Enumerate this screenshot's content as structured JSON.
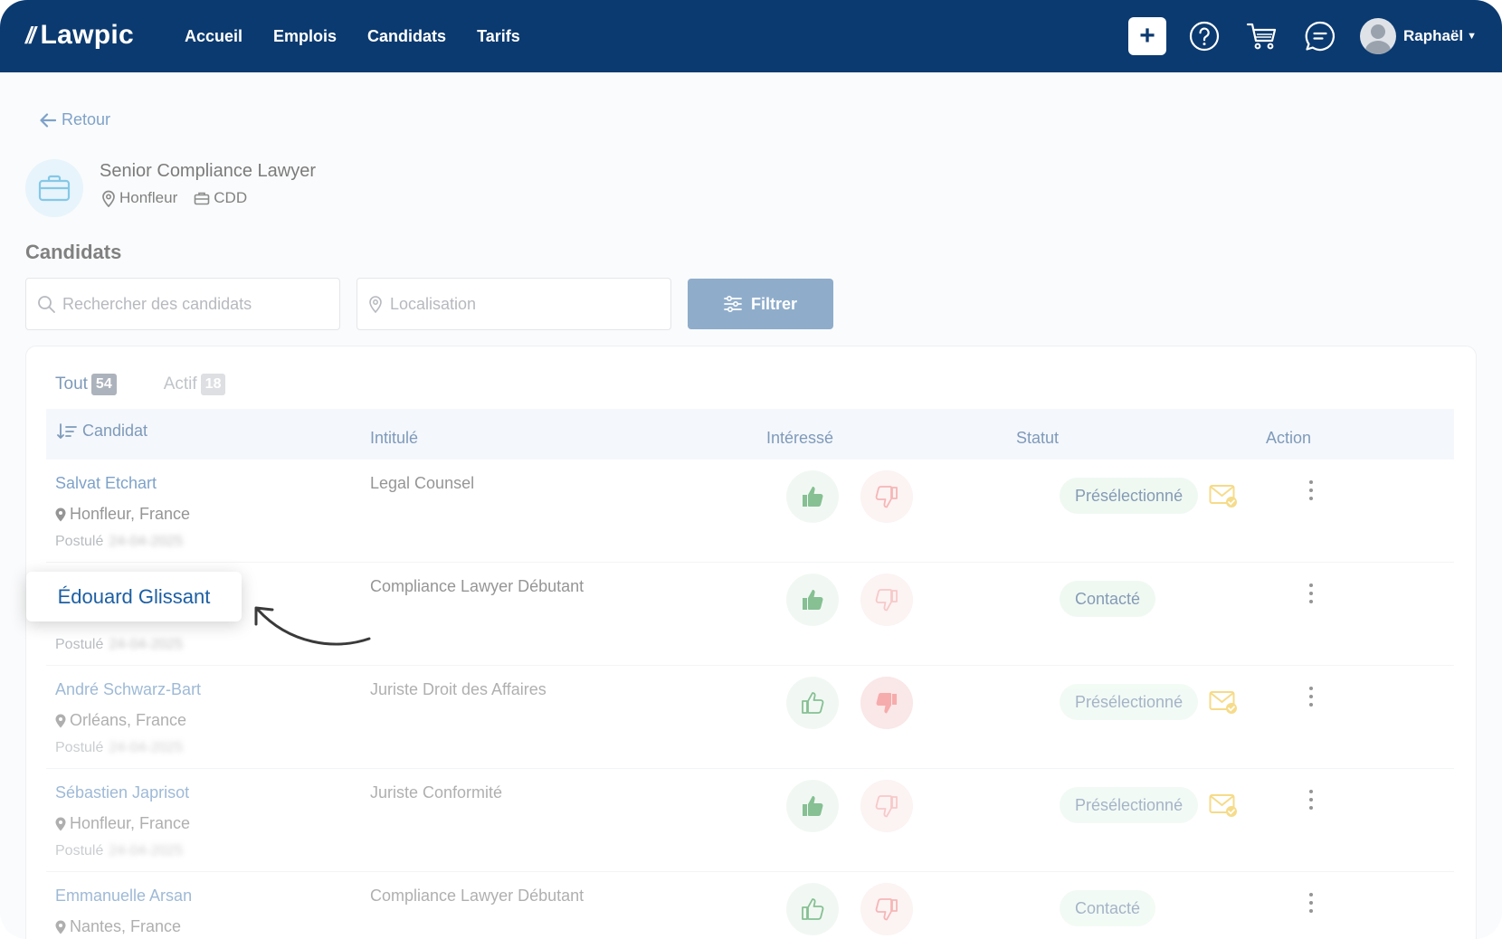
{
  "nav": {
    "brand": "Lawpic",
    "links": [
      "Accueil",
      "Emplois",
      "Candidats",
      "Tarifs"
    ],
    "plus_label": "+",
    "user_name": "Raphaël"
  },
  "back_label": "Retour",
  "job": {
    "title": "Senior Compliance Lawyer",
    "location": "Honfleur",
    "contract": "CDD"
  },
  "section_title": "Candidats",
  "search": {
    "candidates_placeholder": "Rechercher des candidats",
    "location_placeholder": "Localisation",
    "filter_label": "Filtrer"
  },
  "tabs": [
    {
      "label": "Tout",
      "count": "54"
    },
    {
      "label": "Actif",
      "count": "18"
    }
  ],
  "table": {
    "headers": {
      "candidate": "Candidat",
      "title": "Intitulé",
      "interested": "Intéressé",
      "status": "Statut",
      "action": "Action"
    },
    "applied_label": "Postulé",
    "rows": [
      {
        "name": "Salvat Etchart",
        "location": "Honfleur, France",
        "date": "24-04-2025",
        "title": "Legal Counsel",
        "status": "Présélectionné",
        "like": "up"
      },
      {
        "name": "Édouard Glissant",
        "location": "",
        "date": "24-04-2025",
        "title": "Compliance Lawyer Débutant",
        "status": "Contacté",
        "like": "up"
      },
      {
        "name": "André Schwarz-Bart",
        "location": "Orléans, France",
        "date": "24-04-2025",
        "title": "Juriste Droit des Affaires",
        "status": "Présélectionné",
        "like": "down"
      },
      {
        "name": "Sébastien Japrisot",
        "location": "Honfleur, France",
        "date": "24-04-2025",
        "title": "Juriste Conformité",
        "status": "Présélectionné",
        "like": "up"
      },
      {
        "name": "Emmanuelle Arsan",
        "location": "Nantes, France",
        "date": "",
        "title": "Compliance Lawyer Débutant",
        "status": "Contacté",
        "like": "none"
      }
    ]
  },
  "callout": {
    "name": "Édouard Glissant"
  },
  "colors": {
    "nav_bg": "#0b3a70",
    "filter_bg": "#4b7bac",
    "link_blue": "#2f6aa8",
    "like_green": "#3d9a52",
    "dislike_red": "#f08a8a",
    "mail_yellow": "#f0c541",
    "status_bg": "#e5f5ea"
  }
}
